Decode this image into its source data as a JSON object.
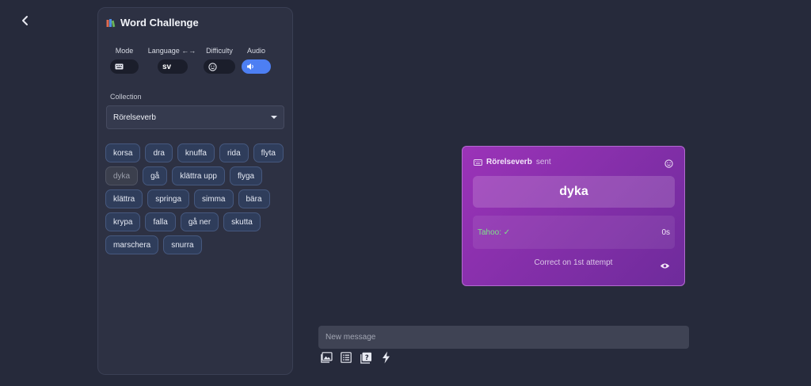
{
  "nav": {
    "back_icon": "chevron-left-icon"
  },
  "panel": {
    "title": "Word Challenge",
    "title_icon": "books-icon",
    "controls": {
      "mode": {
        "label": "Mode",
        "icon": "keyboard-icon"
      },
      "language": {
        "label": "Language ←→",
        "value": "sv"
      },
      "difficulty": {
        "label": "Difficulty",
        "icon": "smiley-icon"
      },
      "audio": {
        "label": "Audio",
        "icon": "speaker-icon",
        "enabled": true
      }
    },
    "collection": {
      "label": "Collection",
      "selected": "Rörelseverb"
    },
    "words": [
      "korsa",
      "dra",
      "knuffa",
      "rida",
      "flyta",
      "dyka",
      "gå",
      "klättra upp",
      "flyga",
      "klättra",
      "springa",
      "simma",
      "bära",
      "krypa",
      "falla",
      "gå ner",
      "skutta",
      "marschera",
      "snurra"
    ],
    "dimmed_word": "dyka"
  },
  "card": {
    "collection_name": "Rörelseverb",
    "sent_label": "sent",
    "word": "dyka",
    "result_user": "Tahoo: ✓",
    "result_time": "0s",
    "footer": "Correct on 1st attempt"
  },
  "composer": {
    "placeholder": "New message",
    "tools": [
      "image-icon",
      "list-icon",
      "help-card-icon",
      "lightning-icon"
    ]
  },
  "colors": {
    "accent": "#4d7ff3",
    "card_purple": "#9b33b8",
    "correct_green": "#7fe08a"
  }
}
